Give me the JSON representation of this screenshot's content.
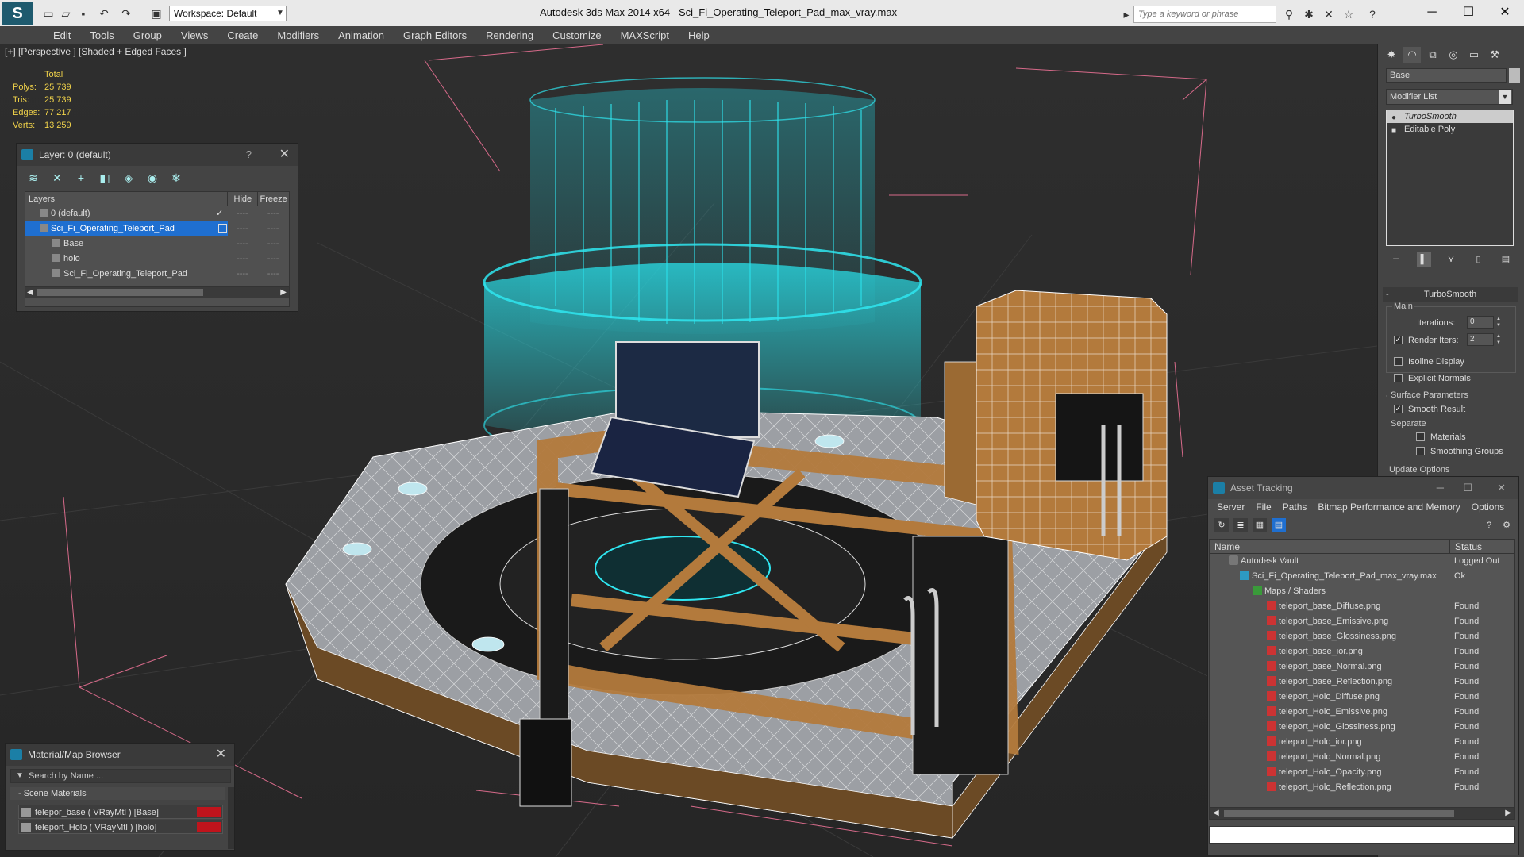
{
  "titlebar": {
    "workspace": "Workspace: Default",
    "app_title": "Autodesk 3ds Max  2014 x64",
    "file_title": "Sci_Fi_Operating_Teleport_Pad_max_vray.max",
    "search_placeholder": "Type a keyword or phrase",
    "help_symbol": "?"
  },
  "menu": [
    "Edit",
    "Tools",
    "Group",
    "Views",
    "Create",
    "Modifiers",
    "Animation",
    "Graph Editors",
    "Rendering",
    "Customize",
    "MAXScript",
    "Help"
  ],
  "viewport": {
    "label": "[+] [Perspective ] [Shaded + Edged Faces ]",
    "stats_header": "Total",
    "stats": [
      {
        "key": "Polys:",
        "value": "25 739"
      },
      {
        "key": "Tris:",
        "value": "25 739"
      },
      {
        "key": "Edges:",
        "value": "77 217"
      },
      {
        "key": "Verts:",
        "value": "13 259"
      }
    ]
  },
  "layer_panel": {
    "title": "Layer: 0 (default)",
    "help": "?",
    "columns": {
      "layers": "Layers",
      "hide": "Hide",
      "freeze": "Freeze"
    },
    "rows": [
      "0 (default)",
      "Sci_Fi_Operating_Teleport_Pad",
      "Base",
      "holo",
      "Sci_Fi_Operating_Teleport_Pad"
    ],
    "dash": "----"
  },
  "material_panel": {
    "title": "Material/Map Browser",
    "search_placeholder": "Search by Name ...",
    "group": "- Scene Materials",
    "materials": [
      "telepor_base  ( VRayMtl )  [Base]",
      "teleport_Holo  ( VRayMtl )  [holo]"
    ]
  },
  "command_panel": {
    "object_name": "Base",
    "modifier_list": "Modifier List",
    "stack": [
      "TurboSmooth",
      "Editable Poly"
    ],
    "rollout": "TurboSmooth",
    "main_label": "Main",
    "iterations_label": "Iterations:",
    "iterations_value": "0",
    "render_iters_label": "Render Iters:",
    "render_iters_value": "2",
    "isoline": "Isoline Display",
    "explicit_normals": "Explicit Normals",
    "surface_params": "Surface Parameters",
    "smooth_result": "Smooth Result",
    "separate": "Separate",
    "materials": "Materials",
    "smoothing_groups": "Smoothing Groups",
    "update_options": "Update Options"
  },
  "asset_tracking": {
    "title": "Asset Tracking",
    "menu": [
      "Server",
      "File",
      "Paths",
      "Bitmap Performance and Memory",
      "Options"
    ],
    "columns": {
      "name": "Name",
      "status": "Status"
    },
    "rows": [
      {
        "name": "Autodesk Vault",
        "status": "Logged Out",
        "icon": "vault-icon"
      },
      {
        "name": "Sci_Fi_Operating_Teleport_Pad_max_vray.max",
        "status": "Ok",
        "icon": "max-file-icon"
      },
      {
        "name": "Maps / Shaders",
        "status": "",
        "icon": "maps-icon"
      },
      {
        "name": "teleport_base_Diffuse.png",
        "status": "Found",
        "icon": "png-icon"
      },
      {
        "name": "teleport_base_Emissive.png",
        "status": "Found",
        "icon": "png-icon"
      },
      {
        "name": "teleport_base_Glossiness.png",
        "status": "Found",
        "icon": "png-icon"
      },
      {
        "name": "teleport_base_ior.png",
        "status": "Found",
        "icon": "png-icon"
      },
      {
        "name": "teleport_base_Normal.png",
        "status": "Found",
        "icon": "png-icon"
      },
      {
        "name": "teleport_base_Reflection.png",
        "status": "Found",
        "icon": "png-icon"
      },
      {
        "name": "teleport_Holo_Diffuse.png",
        "status": "Found",
        "icon": "png-icon"
      },
      {
        "name": "teleport_Holo_Emissive.png",
        "status": "Found",
        "icon": "png-icon"
      },
      {
        "name": "teleport_Holo_Glossiness.png",
        "status": "Found",
        "icon": "png-icon"
      },
      {
        "name": "teleport_Holo_ior.png",
        "status": "Found",
        "icon": "png-icon"
      },
      {
        "name": "teleport_Holo_Normal.png",
        "status": "Found",
        "icon": "png-icon"
      },
      {
        "name": "teleport_Holo_Opacity.png",
        "status": "Found",
        "icon": "png-icon"
      },
      {
        "name": "teleport_Holo_Reflection.png",
        "status": "Found",
        "icon": "png-icon"
      }
    ]
  },
  "colors": {
    "accent": "#1f6fd0",
    "holo": "#23d3e0",
    "wood": "#b37a3c",
    "metal": "#a9a9a9"
  }
}
